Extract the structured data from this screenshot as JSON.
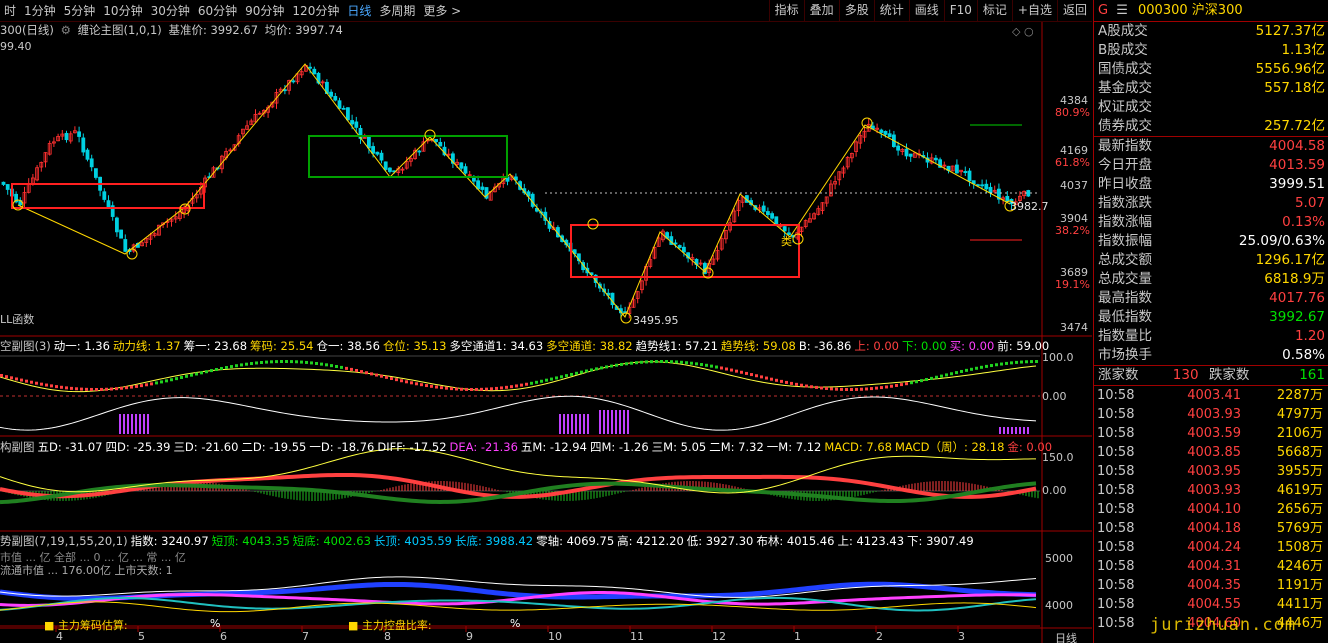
{
  "toolbar": {
    "periods": [
      "时",
      "1分钟",
      "5分钟",
      "10分钟",
      "30分钟",
      "60分钟",
      "90分钟",
      "120分钟",
      "日线",
      "多周期",
      "更多 >"
    ],
    "active_period": "日线",
    "tools": [
      "指标",
      "叠加",
      "多股",
      "统计",
      "画线",
      "F10",
      "标记",
      "+自选",
      "返回"
    ]
  },
  "main_chart": {
    "header_title": "300(日线)",
    "indicator_name": "缠论主图(1,0,1)",
    "base_price_label": "基准价: 3992.67",
    "avg_price_label": "均价: 3997.74",
    "top_left_price": "99.40",
    "y_labels": [
      {
        "price": "4384",
        "pct": "80.9%"
      },
      {
        "price": "4169",
        "pct": "61.8%"
      },
      {
        "price": "4037",
        "pct": ""
      },
      {
        "price": "3904",
        "pct": "38.2%"
      },
      {
        "price": "3689",
        "pct": "19.1%"
      },
      {
        "price": "3474",
        "pct": ""
      }
    ],
    "low_label": "3495.95",
    "right_level_label": "3982.7",
    "bottom_left_text": "LL函数",
    "category_label": "类"
  },
  "sub1": {
    "title": "空副图(3)",
    "items": [
      {
        "k": "动一: 1.36",
        "c": "wht"
      },
      {
        "k": "动力线: 1.37",
        "c": "ylw"
      },
      {
        "k": "筹一: 23.68",
        "c": "wht"
      },
      {
        "k": "筹码: 25.54",
        "c": "ylw"
      },
      {
        "k": "仓一: 38.56",
        "c": "wht"
      },
      {
        "k": "仓位: 35.13",
        "c": "ylw"
      },
      {
        "k": "多空通道1: 34.63",
        "c": "wht"
      },
      {
        "k": "多空通道: 38.82",
        "c": "ylw"
      },
      {
        "k": "趋势线1: 57.21",
        "c": "wht"
      },
      {
        "k": "趋势线: 59.08",
        "c": "ylw"
      },
      {
        "k": "B: -36.86",
        "c": "wht"
      },
      {
        "k": "上: 0.00",
        "c": "red"
      },
      {
        "k": "下: 0.00",
        "c": "grn"
      },
      {
        "k": "买: 0.00",
        "c": "mag"
      },
      {
        "k": "前: 59.00",
        "c": "wht"
      }
    ],
    "y_labels": [
      "100.0",
      "0.00"
    ]
  },
  "sub2": {
    "title": "构副图",
    "items": [
      {
        "k": "五D: -31.07",
        "c": "wht"
      },
      {
        "k": "四D: -25.39",
        "c": "wht"
      },
      {
        "k": "三D: -21.60",
        "c": "wht"
      },
      {
        "k": "二D: -19.55",
        "c": "wht"
      },
      {
        "k": "一D: -18.76",
        "c": "wht"
      },
      {
        "k": "DIFF: -17.52",
        "c": "wht"
      },
      {
        "k": "DEA: -21.36",
        "c": "mag"
      },
      {
        "k": "五M: -12.94",
        "c": "wht"
      },
      {
        "k": "四M: -1.26",
        "c": "wht"
      },
      {
        "k": "三M: 5.05",
        "c": "wht"
      },
      {
        "k": "二M: 7.32",
        "c": "wht"
      },
      {
        "k": "一M: 7.12",
        "c": "wht"
      },
      {
        "k": "MACD: 7.68",
        "c": "ylw"
      },
      {
        "k": "MACD（周）: 28.18",
        "c": "ylw"
      },
      {
        "k": "金: 0.00",
        "c": "red"
      }
    ],
    "y_labels": [
      "150.0",
      "0.00"
    ]
  },
  "sub3": {
    "title": "势副图(7,19,1,55,20,1)",
    "items": [
      {
        "k": "指数: 3240.97",
        "c": "wht"
      },
      {
        "k": "短顶: 4043.35",
        "c": "grn"
      },
      {
        "k": "短底: 4002.63",
        "c": "grn"
      },
      {
        "k": "长顶: 4035.59",
        "c": "cyn"
      },
      {
        "k": "长底: 3988.42",
        "c": "cyn"
      },
      {
        "k": "零轴: 4069.75",
        "c": "wht"
      },
      {
        "k": "高: 4212.20",
        "c": "wht"
      },
      {
        "k": "低: 3927.30",
        "c": "wht"
      },
      {
        "k": "布林: 4015.46",
        "c": "wht"
      },
      {
        "k": "上: 4123.43",
        "c": "wht"
      },
      {
        "k": "下: 3907.49",
        "c": "wht"
      }
    ],
    "overlay_text_1": "市值 ... 亿 全部 ... 0 ... 亿 ... 常 ... 亿",
    "overlay_text_2": "流通市值 ... 176.00亿 上市天数: 1",
    "y_labels": [
      "5000",
      "4000"
    ],
    "bottom_label_1": "主力筹码估算:",
    "bottom_pct": "%",
    "bottom_label_2": "主力控盘比率:",
    "bottom_pct2": "%",
    "x_labels": [
      "4",
      "5",
      "6",
      "7",
      "8",
      "9",
      "10",
      "11",
      "12",
      "1",
      "2",
      "3"
    ],
    "bottom_right": "日线"
  },
  "quote": {
    "marker": "G",
    "menu_icon": "☰",
    "code": "000300",
    "name": "沪深300",
    "stats": [
      {
        "k": "A股成交",
        "v": "5127.37亿",
        "c": "ylw"
      },
      {
        "k": "B股成交",
        "v": "1.13亿",
        "c": "ylw"
      },
      {
        "k": "国债成交",
        "v": "5556.96亿",
        "c": "ylw"
      },
      {
        "k": "基金成交",
        "v": "557.18亿",
        "c": "ylw"
      },
      {
        "k": "权证成交",
        "v": "",
        "c": "ylw"
      },
      {
        "k": "债券成交",
        "v": "257.72亿",
        "c": "ylw"
      }
    ],
    "index_stats": [
      {
        "k": "最新指数",
        "v": "4004.58",
        "c": "red"
      },
      {
        "k": "今日开盘",
        "v": "4013.59",
        "c": "red"
      },
      {
        "k": "昨日收盘",
        "v": "3999.51",
        "c": "wht"
      },
      {
        "k": "指数涨跌",
        "v": "5.07",
        "c": "red"
      },
      {
        "k": "指数涨幅",
        "v": "0.13%",
        "c": "red"
      },
      {
        "k": "指数振幅",
        "v": "25.09/0.63%",
        "c": "wht"
      },
      {
        "k": "总成交额",
        "v": "1296.17亿",
        "c": "ylw"
      },
      {
        "k": "总成交量",
        "v": "6818.9万",
        "c": "ylw"
      },
      {
        "k": "最高指数",
        "v": "4017.76",
        "c": "red"
      },
      {
        "k": "最低指数",
        "v": "3992.67",
        "c": "grn"
      },
      {
        "k": "指数量比",
        "v": "1.20",
        "c": "red"
      },
      {
        "k": "市场换手",
        "v": "0.58%",
        "c": "wht"
      }
    ],
    "rise_label": "涨家数",
    "rise_count": "130",
    "fall_label": "跌家数",
    "fall_count": "161",
    "ticks": [
      {
        "t": "10:58",
        "p": "4003.41",
        "v": "2287万"
      },
      {
        "t": "10:58",
        "p": "4003.93",
        "v": "4797万"
      },
      {
        "t": "10:58",
        "p": "4003.59",
        "v": "2106万"
      },
      {
        "t": "10:58",
        "p": "4003.85",
        "v": "5668万"
      },
      {
        "t": "10:58",
        "p": "4003.95",
        "v": "3955万"
      },
      {
        "t": "10:58",
        "p": "4003.93",
        "v": "4619万"
      },
      {
        "t": "10:58",
        "p": "4004.10",
        "v": "2656万"
      },
      {
        "t": "10:58",
        "p": "4004.18",
        "v": "5769万"
      },
      {
        "t": "10:58",
        "p": "4004.24",
        "v": "1508万"
      },
      {
        "t": "10:58",
        "p": "4004.31",
        "v": "4246万"
      },
      {
        "t": "10:58",
        "p": "4004.35",
        "v": "1191万"
      },
      {
        "t": "10:58",
        "p": "4004.55",
        "v": "4411万"
      },
      {
        "t": "10:58",
        "p": "4004.60",
        "v": "4446万"
      }
    ]
  },
  "watermark": "jurizhuan.com",
  "colors": {
    "up": "#ff3030",
    "down": "#00d0e0",
    "frame": "#a00000",
    "accent": "#ffd700"
  }
}
